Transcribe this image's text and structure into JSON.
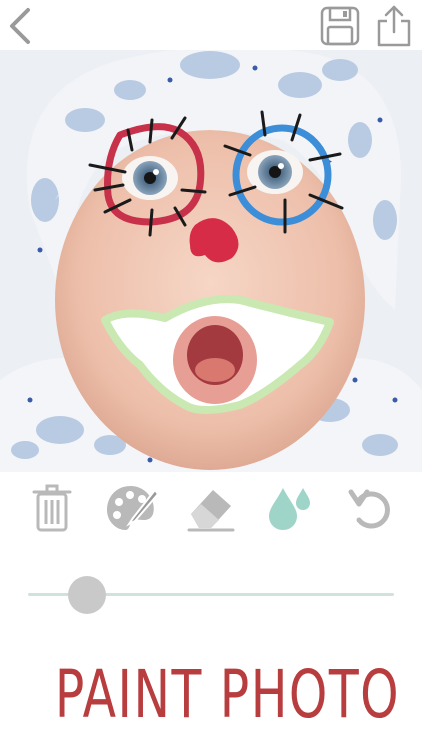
{
  "header": {
    "back_icon": "chevron-left-icon",
    "save_icon": "floppy-disk-icon",
    "share_icon": "share-icon"
  },
  "photo": {
    "description": ""
  },
  "tools": [
    {
      "id": "trash",
      "icon": "trash-icon"
    },
    {
      "id": "palette",
      "icon": "palette-brush-icon"
    },
    {
      "id": "eraser",
      "icon": "eraser-icon"
    },
    {
      "id": "drop",
      "icon": "water-drop-icon",
      "active": true
    },
    {
      "id": "undo",
      "icon": "undo-icon"
    }
  ],
  "slider": {
    "value": 0.16
  },
  "brand": {
    "title": "PAINT PHOTO"
  },
  "colors": {
    "icon_gray": "#b9b9b9",
    "accent_teal": "#9fd4c8",
    "brand_red": "#b83d3f",
    "slider_track": "#cfe3dc"
  }
}
